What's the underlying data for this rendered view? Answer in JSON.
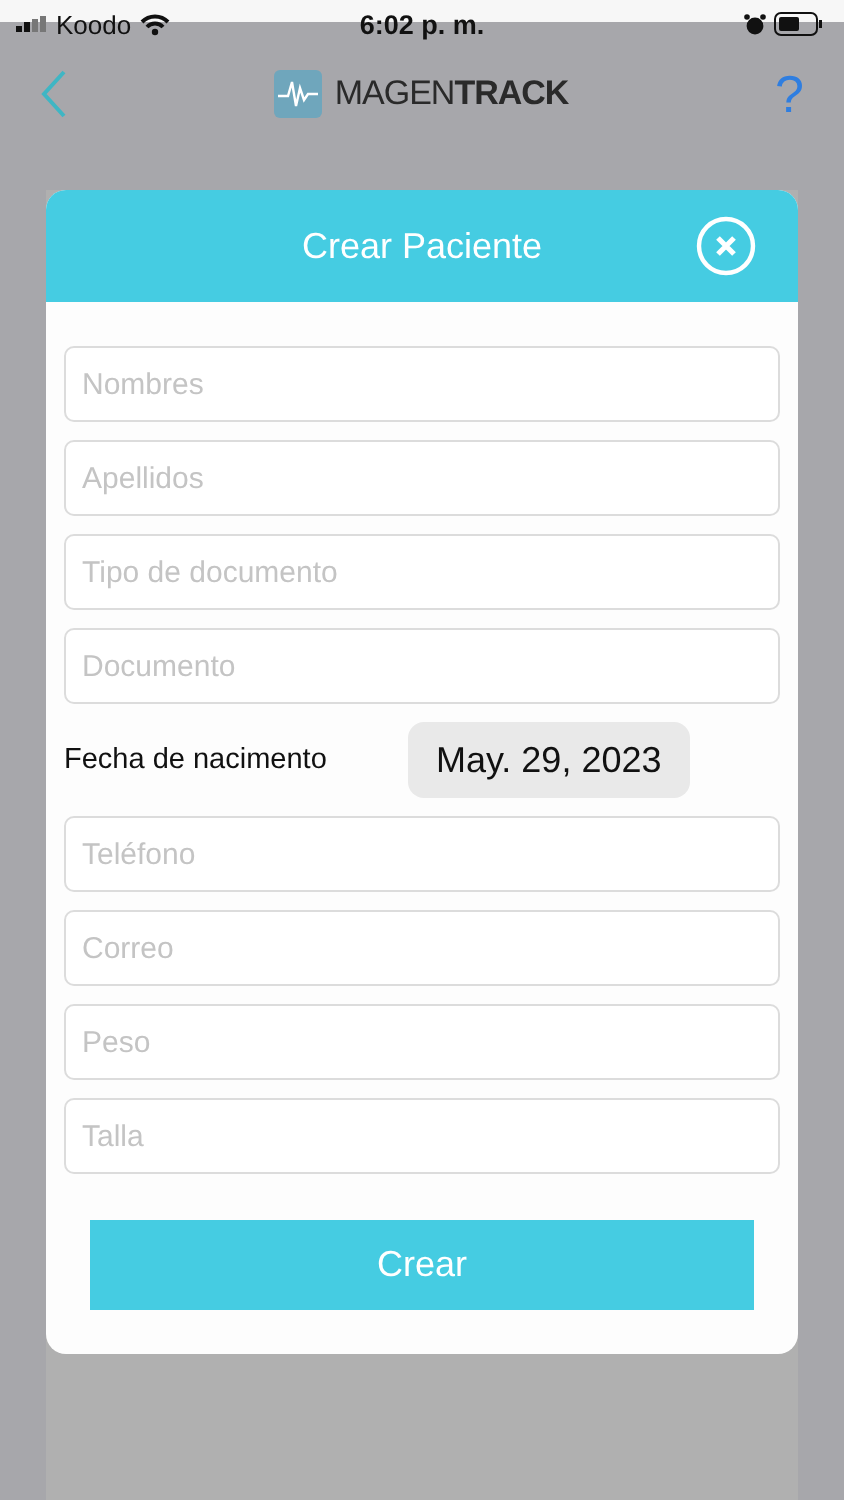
{
  "status_bar": {
    "carrier": "Koodo",
    "time": "6:02 p. m."
  },
  "header": {
    "logo": "MAGEN**TRACK**",
    "help": "?"
  },
  "modal": {
    "title": "Crear Paciente",
    "fields": [
      {
        "kind": "input",
        "placeholder": "Nombres"
      },
      {
        "kind": "input",
        "placeholder": "Apellidos"
      },
      {
        "kind": "input",
        "placeholder": "Tipo de documento"
      },
      {
        "kind": "input",
        "placeholder": "Documento"
      },
      {
        "kind": "date",
        "label": "Fecha de nacimento",
        "value": "May. 29, 2023"
      },
      {
        "kind": "input",
        "placeholder": "Teléfono"
      },
      {
        "kind": "input",
        "placeholder": "Correo"
      },
      {
        "kind": "input",
        "placeholder": "Peso"
      },
      {
        "kind": "input",
        "placeholder": "Talla"
      }
    ],
    "submit": "Crear"
  }
}
